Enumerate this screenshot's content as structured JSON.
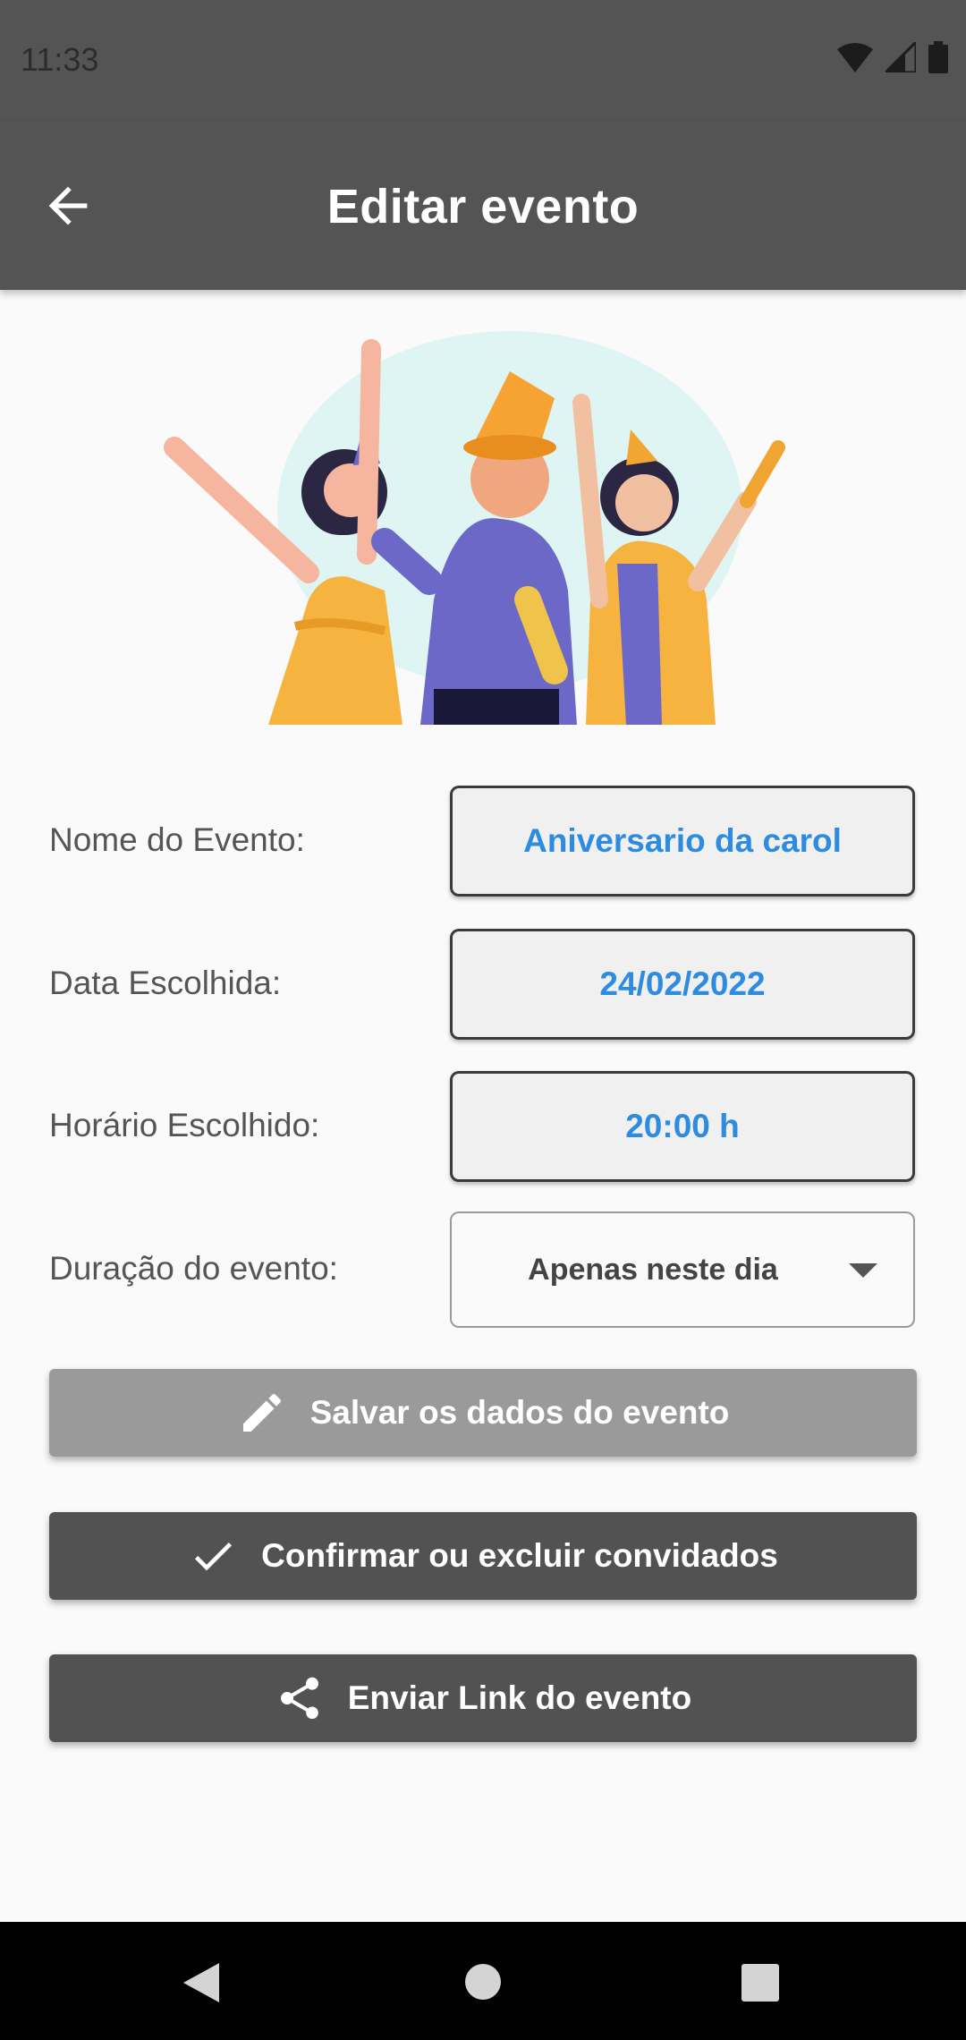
{
  "status_bar": {
    "time": "11:33"
  },
  "app_bar": {
    "title": "Editar evento"
  },
  "form": {
    "name_label": "Nome do Evento:",
    "name_value": "Aniversario da carol",
    "date_label": "Data Escolhida:",
    "date_value": "24/02/2022",
    "time_label": "Horário Escolhido:",
    "time_value": "20:00 h",
    "duration_label": "Duração do evento:",
    "duration_value": "Apenas neste dia"
  },
  "buttons": {
    "save": "Salvar os dados do evento",
    "confirm": "Confirmar ou excluir convidados",
    "share": "Enviar Link do evento"
  },
  "colors": {
    "app_bar": "#545454",
    "field_text": "#2d8be0",
    "save_button": "#9a9a9a",
    "dark_button": "#525252"
  }
}
